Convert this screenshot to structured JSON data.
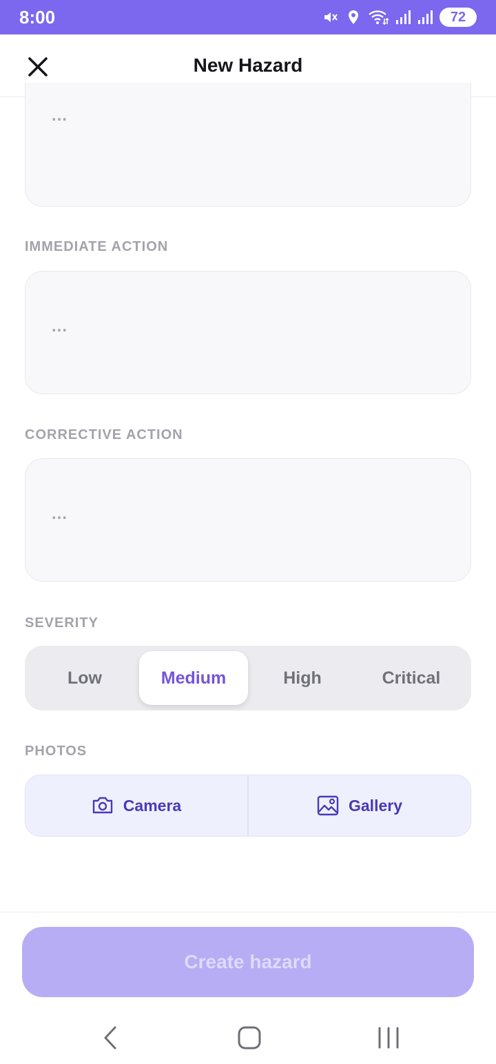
{
  "status_bar": {
    "time": "8:00",
    "battery": "72",
    "icons": [
      "mute-icon",
      "location-icon",
      "wifi-icon",
      "signal-icon",
      "signal-icon"
    ]
  },
  "header": {
    "title": "New Hazard",
    "close_icon": "close-icon"
  },
  "form": {
    "top_field": {
      "placeholder": "..."
    },
    "immediate_action": {
      "label": "IMMEDIATE ACTION",
      "placeholder": "..."
    },
    "corrective_action": {
      "label": "CORRECTIVE ACTION",
      "placeholder": "..."
    },
    "severity": {
      "label": "SEVERITY",
      "options": [
        "Low",
        "Medium",
        "High",
        "Critical"
      ],
      "selected": "Medium"
    },
    "photos": {
      "label": "PHOTOS",
      "camera_label": "Camera",
      "gallery_label": "Gallery"
    }
  },
  "footer": {
    "create_label": "Create hazard"
  },
  "colors": {
    "accent": "#7b68ee",
    "selected_text": "#7454d9",
    "photo_text": "#4a38b8",
    "disabled_button": "#b7adf5"
  }
}
